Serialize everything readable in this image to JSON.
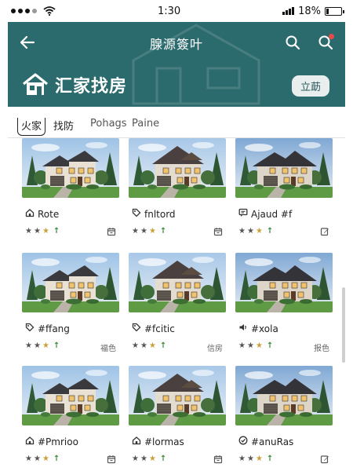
{
  "status": {
    "time": "1:30",
    "battery": "18%",
    "battery_level": 0.18
  },
  "header": {
    "app_title": "腺源簽叶",
    "brand_title": "汇家找房",
    "action_button": "立莇"
  },
  "tabs": [
    {
      "label": "火家",
      "active": true
    },
    {
      "label": "找防",
      "active": false
    },
    {
      "label": "Pohags",
      "active": false
    },
    {
      "label": "Paine",
      "active": false
    }
  ],
  "listings": [
    {
      "name": "Rote",
      "name_icon": "home-outline-icon",
      "rating": 3,
      "trend": "up-arrow-icon",
      "meta": "",
      "meta_icon": "calendar-icon",
      "house": 0
    },
    {
      "name": "fnltord",
      "name_icon": "tag-icon",
      "rating": 3,
      "trend": "up-arrow-icon",
      "meta": "",
      "meta_icon": "calendar-icon",
      "house": 1
    },
    {
      "name": "Ajaud #f",
      "name_icon": "chat-icon",
      "rating": 3,
      "trend": "up-arrow-icon",
      "meta": "",
      "meta_icon": "edit-icon",
      "house": 2
    },
    {
      "name": "#ffang",
      "name_icon": "tag-icon",
      "rating": 3,
      "trend": "up-arrow-icon",
      "meta": "福色",
      "meta_icon": "",
      "house": 0
    },
    {
      "name": "#fcitic",
      "name_icon": "tag-icon",
      "rating": 3,
      "trend": "up-arrow-icon",
      "meta": "信房",
      "meta_icon": "",
      "house": 1
    },
    {
      "name": "#xola",
      "name_icon": "speaker-icon",
      "rating": 3,
      "trend": "up-arrow-icon",
      "meta": "报色",
      "meta_icon": "",
      "house": 2
    },
    {
      "name": "#Pmrioo",
      "name_icon": "home-outline-icon",
      "rating": 3,
      "trend": "up-arrow-icon",
      "meta": "",
      "meta_icon": "calendar-icon",
      "house": 0
    },
    {
      "name": "#lormas",
      "name_icon": "home-outline-icon",
      "rating": 3,
      "trend": "up-arrow-icon",
      "meta": "",
      "meta_icon": "calendar-icon",
      "house": 1
    },
    {
      "name": "#anuRas",
      "name_icon": "check-circle-icon",
      "rating": 3,
      "trend": "up-arrow-icon",
      "meta": "",
      "meta_icon": "edit-icon",
      "house": 2
    }
  ],
  "colors": {
    "header": "#2c6b6d",
    "accent_gold": "#c9a23a",
    "trend_green": "#3a8a3a",
    "notification": "#e84a4a"
  }
}
